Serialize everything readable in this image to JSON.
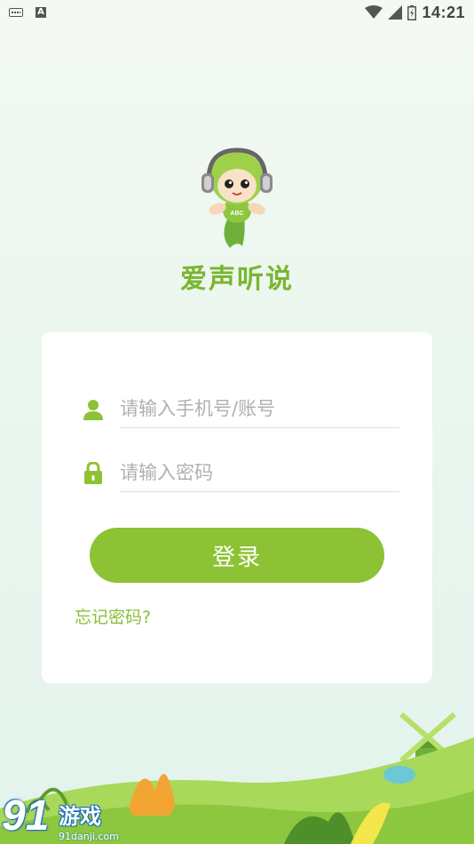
{
  "status_bar": {
    "time": "14:21",
    "notification_icons": [
      "keyboard-icon",
      "a-notification-icon"
    ],
    "system_icons": [
      "wifi-icon",
      "cell-signal-icon",
      "battery-icon"
    ]
  },
  "app": {
    "name": "爱声听说",
    "mascot_label": "ABC"
  },
  "login": {
    "username_placeholder": "请输入手机号/账号",
    "password_placeholder": "请输入密码",
    "submit_label": "登录",
    "forgot_label": "忘记密码?"
  },
  "watermark": {
    "number": "91",
    "text": "游戏",
    "url": "91danji.com"
  },
  "colors": {
    "accent": "#8dc234",
    "text_accent": "#7bb531",
    "background": "#eaf6ee",
    "card": "#ffffff"
  }
}
